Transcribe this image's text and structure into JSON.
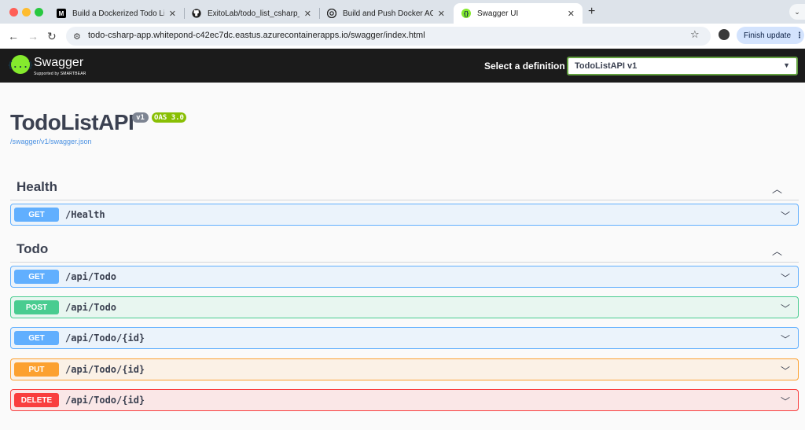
{
  "browser": {
    "tabs": [
      {
        "title": "Build a Dockerized Todo List",
        "favicon": "M",
        "favicon_color": "#000000"
      },
      {
        "title": "ExitoLab/todo_list_csharp_do",
        "favicon": "github-icon",
        "favicon_color": "#1f1f1f"
      },
      {
        "title": "Build and Push Docker ACR",
        "favicon": "openai-icon",
        "favicon_color": "#1f1f1f"
      },
      {
        "title": "Swagger UI",
        "favicon": "{}",
        "favicon_color": "#85ea2d"
      }
    ],
    "active_tab": 3,
    "url": "todo-csharp-app.whitepond-c42ec7dc.eastus.azurecontainerapps.io/swagger/index.html",
    "finish_update_label": "Finish update"
  },
  "swagger": {
    "brand": "Swagger",
    "brand_sub": "Supported by SMARTBEAR",
    "select_label": "Select a definition",
    "definition": "TodoListAPI v1",
    "logo_glyph": "{...}"
  },
  "info": {
    "title": "TodoListAPI",
    "version": "v1",
    "oas": "OAS 3.0",
    "spec_url": "/swagger/v1/swagger.json"
  },
  "tags": [
    {
      "name": "Health",
      "operations": [
        {
          "method": "GET",
          "path": "/Health"
        }
      ]
    },
    {
      "name": "Todo",
      "operations": [
        {
          "method": "GET",
          "path": "/api/Todo"
        },
        {
          "method": "POST",
          "path": "/api/Todo"
        },
        {
          "method": "GET",
          "path": "/api/Todo/{id}"
        },
        {
          "method": "PUT",
          "path": "/api/Todo/{id}"
        },
        {
          "method": "DELETE",
          "path": "/api/Todo/{id}"
        }
      ]
    }
  ],
  "colors": {
    "get": "#61affe",
    "post": "#49cc90",
    "put": "#fca130",
    "delete": "#f93e3e",
    "swagger_green": "#85ea2d"
  }
}
